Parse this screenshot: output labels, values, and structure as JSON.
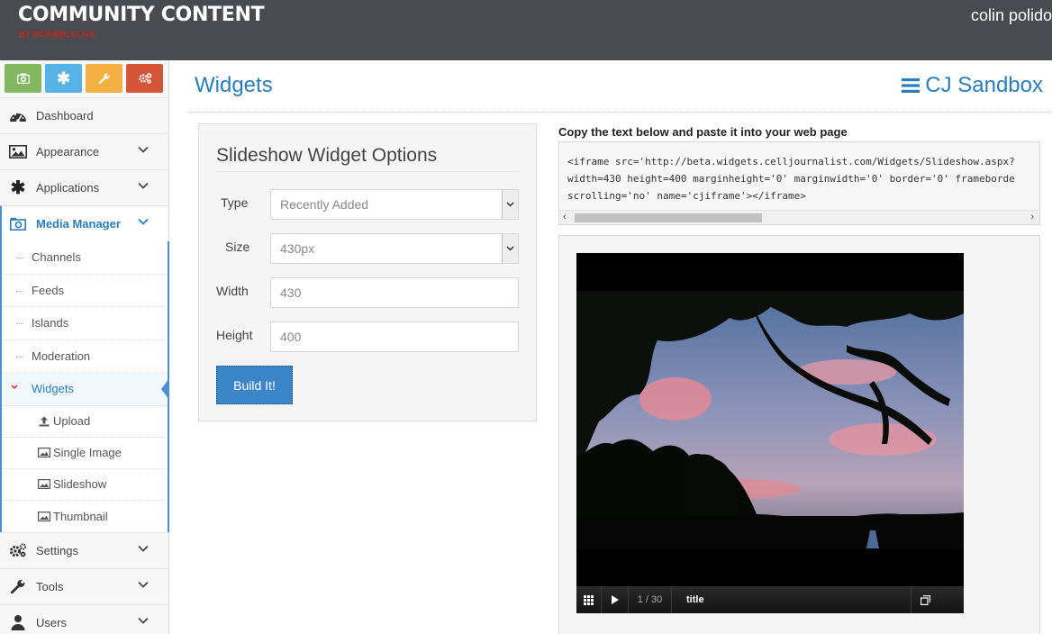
{
  "header": {
    "brand": "COMMUNITY CONTENT",
    "brand_sub": "BY SCRIBBLELIVE",
    "user_name": "colin polido"
  },
  "sidebar": {
    "shortcuts": [
      {
        "icon": "camera-icon",
        "color": "#84b762"
      },
      {
        "icon": "asterisk-icon",
        "color": "#59b2e5"
      },
      {
        "icon": "wrench-icon",
        "color": "#f5b044"
      },
      {
        "icon": "gears-icon",
        "color": "#d55538"
      }
    ],
    "items": [
      {
        "label": "Dashboard",
        "icon": "dashboard-icon"
      },
      {
        "label": "Appearance",
        "icon": "picture-icon"
      },
      {
        "label": "Applications",
        "icon": "asterisk-icon"
      },
      {
        "label": "Media Manager",
        "icon": "camera-icon"
      },
      {
        "label": "Settings",
        "icon": "gears-icon"
      },
      {
        "label": "Tools",
        "icon": "wrench-icon"
      },
      {
        "label": "Users",
        "icon": "user-icon"
      }
    ],
    "media_sub": [
      "Channels",
      "Feeds",
      "Islands",
      "Moderation",
      "Widgets"
    ],
    "widgets_sub": [
      "Upload",
      "Single Image",
      "Slideshow",
      "Thumbnail"
    ]
  },
  "main": {
    "page_title": "Widgets",
    "site_name": "CJ Sandbox",
    "options": {
      "title": "Slideshow Widget Options",
      "type_label": "Type",
      "type_value": "Recently Added",
      "size_label": "Size",
      "size_value": "430px",
      "width_label": "Width",
      "width_value": "430",
      "height_label": "Height",
      "height_value": "400",
      "build_label": "Build It!"
    },
    "embed": {
      "instruction": "Copy the text below and paste it into your web page",
      "code": "<iframe src='http://beta.widgets.celljournalist.com/Widgets/Slideshow.aspx?\nwidth=430 height=400 marginheight='0' marginwidth='0' border='0' frameborde\nscrolling='no' name='cjiframe'></iframe>"
    },
    "player": {
      "counter": "1 / 30",
      "title": "title"
    }
  },
  "colors": {
    "header_bg": "#4a4b50",
    "accent": "#2b7dbc",
    "button": "#3b86c8",
    "brand_red": "#c8261b"
  }
}
